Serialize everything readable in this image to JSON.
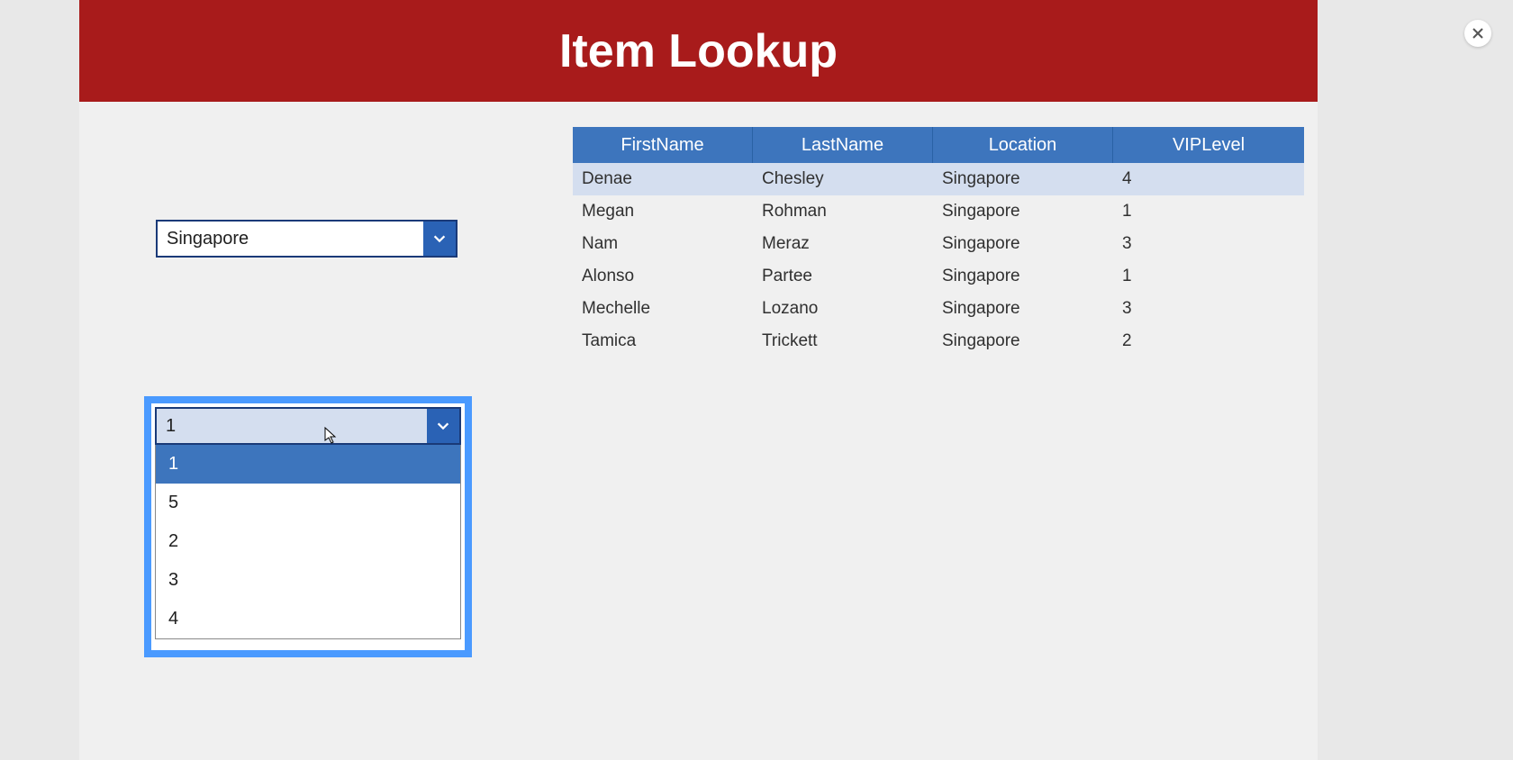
{
  "header": {
    "title": "Item Lookup"
  },
  "location_dropdown": {
    "value": "Singapore"
  },
  "vip_dropdown": {
    "value": "1",
    "options": [
      "1",
      "5",
      "2",
      "3",
      "4"
    ],
    "selected_index": 0
  },
  "table": {
    "columns": [
      "FirstName",
      "LastName",
      "Location",
      "VIPLevel"
    ],
    "rows": [
      {
        "first": "Denae",
        "last": "Chesley",
        "location": "Singapore",
        "vip": "4",
        "selected": true
      },
      {
        "first": "Megan",
        "last": "Rohman",
        "location": "Singapore",
        "vip": "1",
        "selected": false
      },
      {
        "first": "Nam",
        "last": "Meraz",
        "location": "Singapore",
        "vip": "3",
        "selected": false
      },
      {
        "first": "Alonso",
        "last": "Partee",
        "location": "Singapore",
        "vip": "1",
        "selected": false
      },
      {
        "first": "Mechelle",
        "last": "Lozano",
        "location": "Singapore",
        "vip": "3",
        "selected": false
      },
      {
        "first": "Tamica",
        "last": "Trickett",
        "location": "Singapore",
        "vip": "2",
        "selected": false
      }
    ]
  },
  "colors": {
    "header_bg": "#a81b1b",
    "accent_blue": "#3d75bd",
    "highlight_border": "#4a9aff",
    "selected_row": "#d4deef"
  }
}
